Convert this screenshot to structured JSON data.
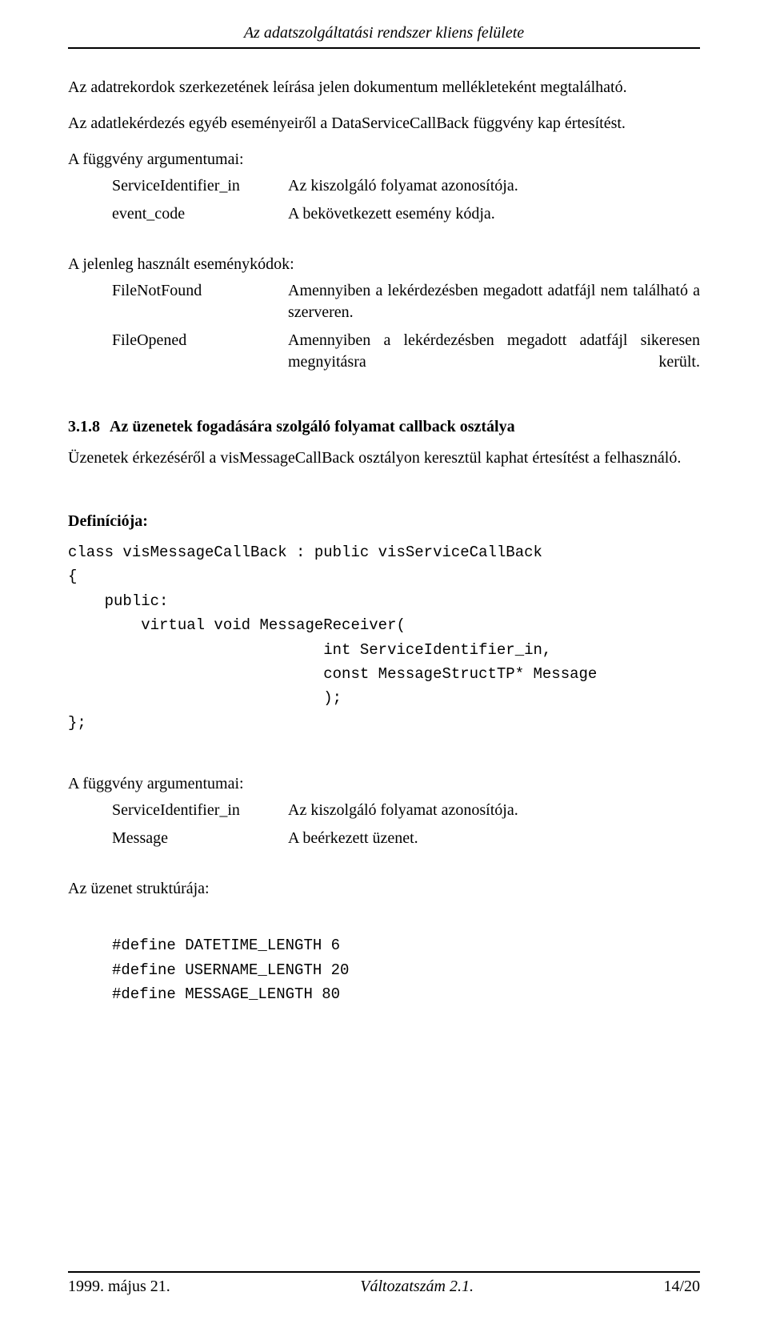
{
  "header": {
    "title": "Az adatszolgáltatási rendszer kliens felülete"
  },
  "content": {
    "p1": "Az adatrekordok szerkezetének leírása jelen dokumentum mellékleteként megtalálható.",
    "p2": "Az adatlekérdezés egyéb eseményeiről a DataServiceCallBack függvény kap értesítést.",
    "args1_intro": "A függvény argumentumai:",
    "args1": [
      {
        "key": "ServiceIdentifier_in",
        "val": "Az kiszolgáló folyamat azonosítója."
      },
      {
        "key": "event_code",
        "val": "A bekövetkezett esemény kódja."
      }
    ],
    "events_intro": "A jelenleg használt eseménykódok:",
    "events": [
      {
        "key": "FileNotFound",
        "val": "Amennyiben a lekérdezésben megadott adatfájl nem található a szerveren."
      },
      {
        "key": "FileOpened",
        "val": "Amennyiben a lekérdezésben megadott adatfájl sikeresen megnyitásra került."
      }
    ],
    "heading_num": "3.1.8",
    "heading_text": "Az üzenetek fogadására szolgáló folyamat callback osztálya",
    "p3": "Üzenetek érkezéséről a visMessageCallBack osztályon keresztül kaphat értesítést a felhasználó.",
    "def_label": "Definíciója:",
    "code1": "class visMessageCallBack : public visServiceCallBack\n{\n    public:\n        virtual void MessageReceiver(\n                            int ServiceIdentifier_in,\n                            const MessageStructTP* Message\n                            );\n};",
    "args2_intro": "A függvény argumentumai:",
    "args2": [
      {
        "key": "ServiceIdentifier_in",
        "val": "Az kiszolgáló folyamat azonosítója."
      },
      {
        "key": "Message",
        "val": "A beérkezett üzenet."
      }
    ],
    "struct_intro": "Az üzenet struktúrája:",
    "code2": "#define DATETIME_LENGTH 6\n#define USERNAME_LENGTH 20\n#define MESSAGE_LENGTH 80"
  },
  "footer": {
    "left": "1999. május 21.",
    "center": "Változatszám 2.1.",
    "right": "14/20"
  }
}
